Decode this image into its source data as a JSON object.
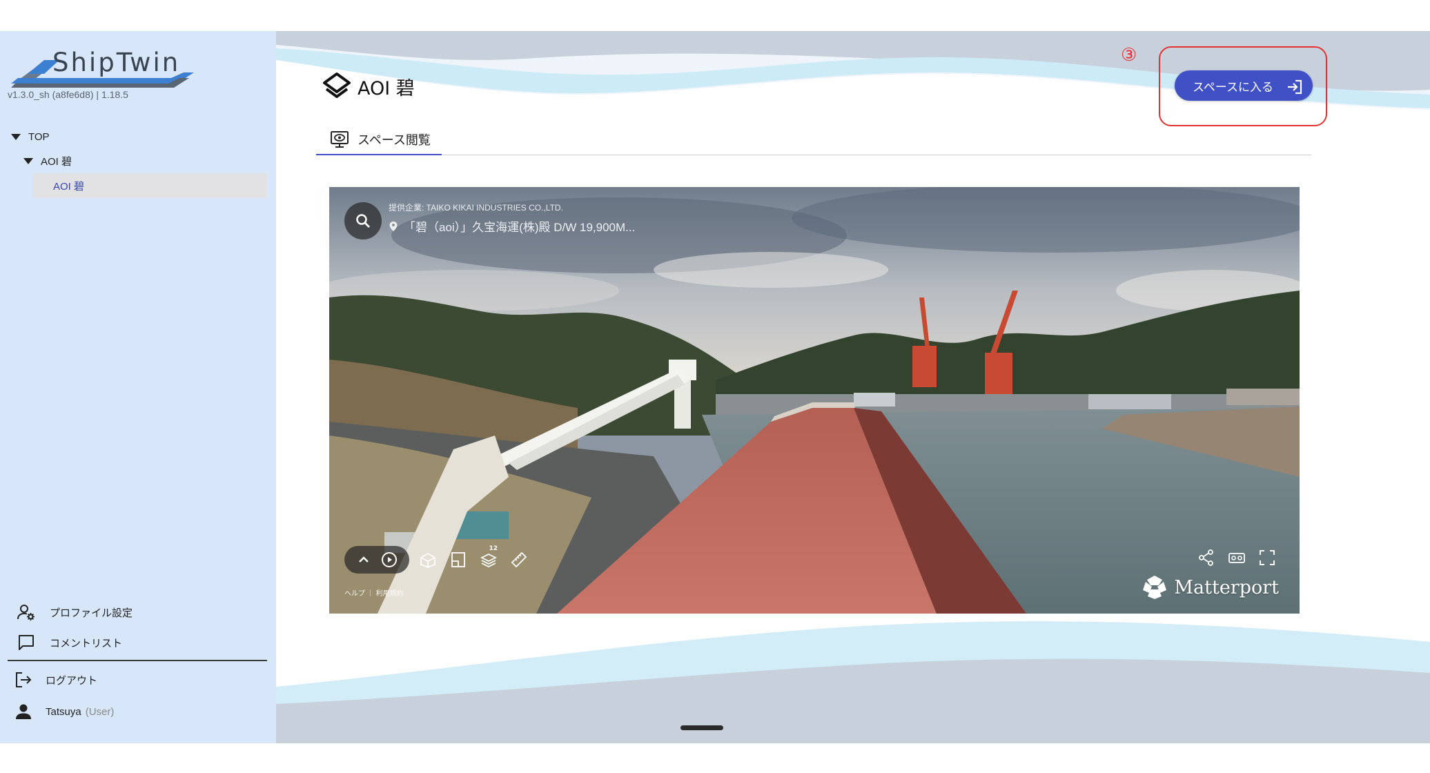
{
  "app": {
    "logo_text": "ShipTwin",
    "version": "v1.3.0_sh (a8fe6d8) | 1.18.5"
  },
  "sidebar": {
    "tree": [
      {
        "label": "TOP",
        "expanded": true
      },
      {
        "label": "AOI 碧",
        "expanded": true
      },
      {
        "label": "AOI 碧",
        "selected": true
      }
    ],
    "menu": [
      {
        "label": "プロファイル設定",
        "icon": "user-gear-icon"
      },
      {
        "label": "コメントリスト",
        "icon": "comment-icon"
      }
    ],
    "logout_label": "ログアウト",
    "user": {
      "name": "Tatsuya",
      "role": "(User)"
    }
  },
  "main": {
    "title": "AOI 碧",
    "enter_button_label": "スペースに入る",
    "step_marker": "③",
    "tabs": [
      {
        "label": "スペース閲覧",
        "active": true,
        "icon": "monitor-eye-icon"
      }
    ]
  },
  "viewer": {
    "provider": "提供企業: TAIKO KIKAI INDUSTRIES CO.,LTD.",
    "location": "「碧（aoi）」久宝海運(株)殿 D/W 19,900M...",
    "badge": "12",
    "footer": "ヘルプ ｜ 利用規約",
    "brand": "Matterport"
  },
  "colors": {
    "primary": "#3f51c4",
    "highlight": "#e53131",
    "sidebar_bg": "#d7e6f8",
    "selected_text": "#3447a6"
  }
}
